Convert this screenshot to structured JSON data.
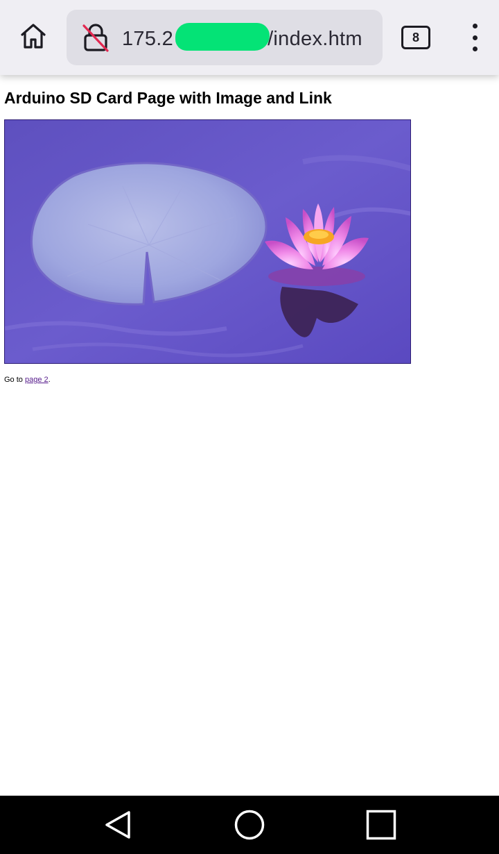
{
  "browser": {
    "url_prefix": "175.2",
    "url_suffix": "/index.htm",
    "tab_count": "8"
  },
  "page": {
    "title": "Arduino SD Card Page with Image and Link",
    "image_description": "Pink water lily flower next to a lily pad on purple water",
    "link_prefix": "Go to ",
    "link_text": "page 2",
    "link_suffix": "."
  },
  "icons": {
    "home": "home-icon",
    "lock": "insecure-lock-icon",
    "tabs": "tabs-counter-icon",
    "menu": "overflow-menu-icon",
    "back": "nav-back-icon",
    "home_nav": "nav-home-icon",
    "recents": "nav-recents-icon"
  },
  "colors": {
    "toolbar_bg": "#efeef3",
    "urlbar_bg": "#dfdee5",
    "redaction": "#04e376",
    "insecure_slash": "#e22850",
    "link_visited": "#551a8b",
    "water": "#6457c4",
    "navbar_bg": "#000000"
  }
}
